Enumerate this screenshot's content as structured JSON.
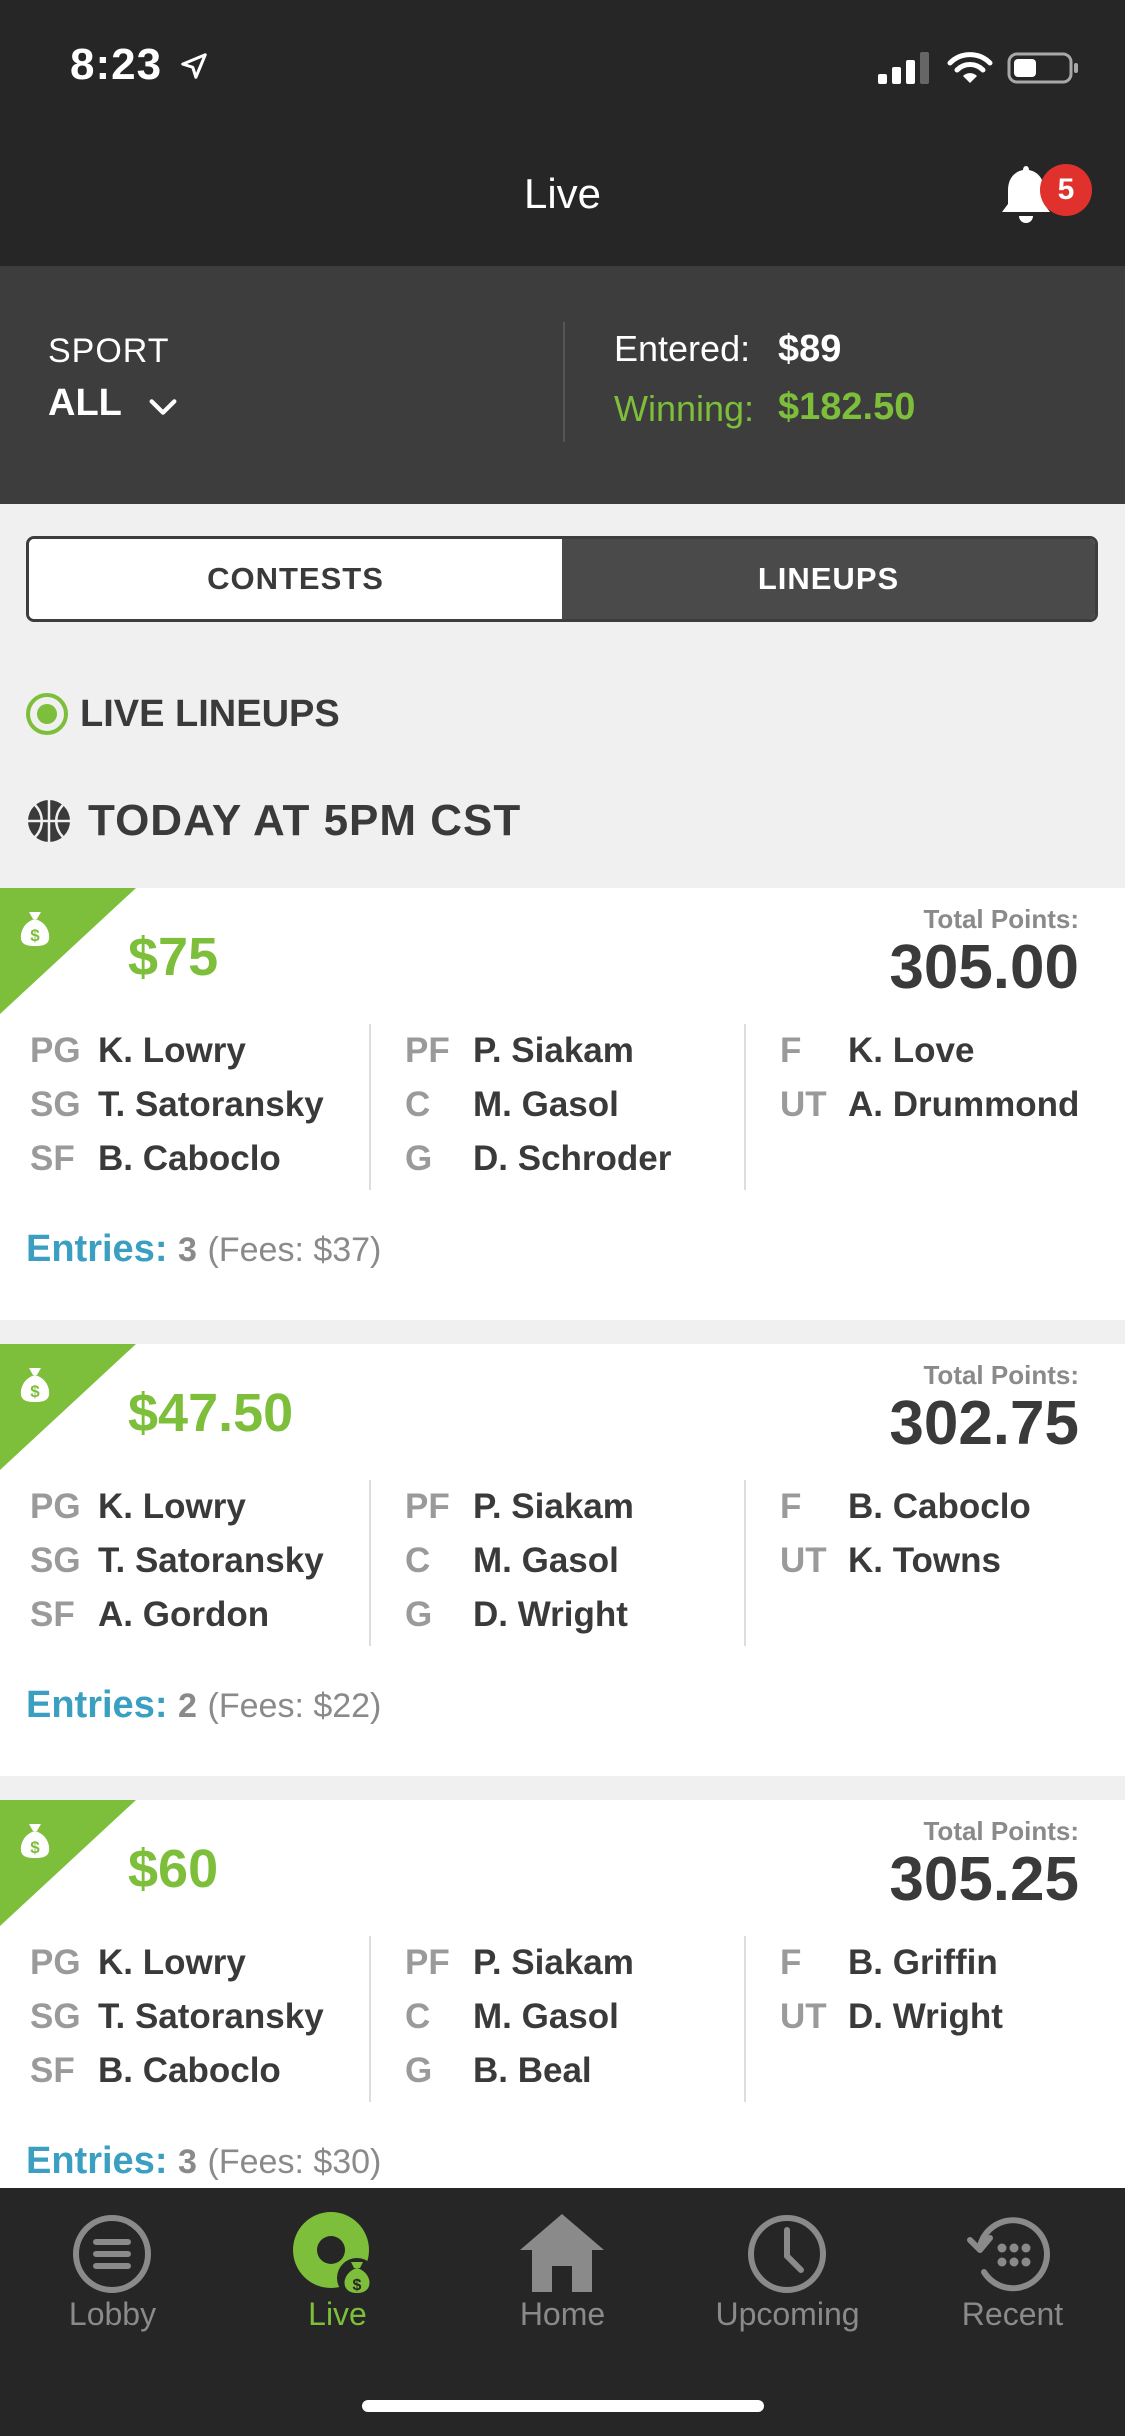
{
  "status": {
    "time": "8:23"
  },
  "nav": {
    "title": "Live",
    "badge": "5"
  },
  "summary": {
    "sport_label": "SPORT",
    "sport_value": "ALL",
    "entered_label": "Entered:",
    "entered_value": "$89",
    "winning_label": "Winning:",
    "winning_value": "$182.50"
  },
  "tabs": {
    "contests": "CONTESTS",
    "lineups": "LINEUPS"
  },
  "section": {
    "live_lineups": "LIVE LINEUPS",
    "today": "TODAY AT 5PM CST"
  },
  "cards": [
    {
      "amount": "$75",
      "total_label": "Total Points:",
      "total": "305.00",
      "col1": [
        {
          "pos": "PG",
          "name": "K. Lowry"
        },
        {
          "pos": "SG",
          "name": "T. Satoransky"
        },
        {
          "pos": "SF",
          "name": "B. Caboclo"
        }
      ],
      "col2": [
        {
          "pos": "PF",
          "name": "P. Siakam"
        },
        {
          "pos": "C",
          "name": "M. Gasol"
        },
        {
          "pos": "G",
          "name": "D. Schroder"
        }
      ],
      "col3": [
        {
          "pos": "F",
          "name": "K. Love"
        },
        {
          "pos": "UT",
          "name": "A. Drummond"
        }
      ],
      "entries_label": "Entries:",
      "entries_count": "3",
      "fees": "(Fees: $37)"
    },
    {
      "amount": "$47.50",
      "total_label": "Total Points:",
      "total": "302.75",
      "col1": [
        {
          "pos": "PG",
          "name": "K. Lowry"
        },
        {
          "pos": "SG",
          "name": "T. Satoransky"
        },
        {
          "pos": "SF",
          "name": "A. Gordon"
        }
      ],
      "col2": [
        {
          "pos": "PF",
          "name": "P. Siakam"
        },
        {
          "pos": "C",
          "name": "M. Gasol"
        },
        {
          "pos": "G",
          "name": "D. Wright"
        }
      ],
      "col3": [
        {
          "pos": "F",
          "name": "B. Caboclo"
        },
        {
          "pos": "UT",
          "name": "K. Towns"
        }
      ],
      "entries_label": "Entries:",
      "entries_count": "2",
      "fees": "(Fees: $22)"
    },
    {
      "amount": "$60",
      "total_label": "Total Points:",
      "total": "305.25",
      "col1": [
        {
          "pos": "PG",
          "name": "K. Lowry"
        },
        {
          "pos": "SG",
          "name": "T. Satoransky"
        },
        {
          "pos": "SF",
          "name": "B. Caboclo"
        }
      ],
      "col2": [
        {
          "pos": "PF",
          "name": "P. Siakam"
        },
        {
          "pos": "C",
          "name": "M. Gasol"
        },
        {
          "pos": "G",
          "name": "B. Beal"
        }
      ],
      "col3": [
        {
          "pos": "F",
          "name": "B. Griffin"
        },
        {
          "pos": "UT",
          "name": "D. Wright"
        }
      ],
      "entries_label": "Entries:",
      "entries_count": "3",
      "fees": "(Fees: $30)"
    }
  ],
  "tabbar": [
    {
      "label": "Lobby",
      "icon": "lobby-icon"
    },
    {
      "label": "Live",
      "icon": "live-icon"
    },
    {
      "label": "Home",
      "icon": "home-icon"
    },
    {
      "label": "Upcoming",
      "icon": "clock-icon"
    },
    {
      "label": "Recent",
      "icon": "recent-icon"
    }
  ],
  "colors": {
    "accent": "#7dbe3a",
    "entries": "#3a9fc0",
    "dark": "#262626",
    "badge": "#e0312c"
  }
}
